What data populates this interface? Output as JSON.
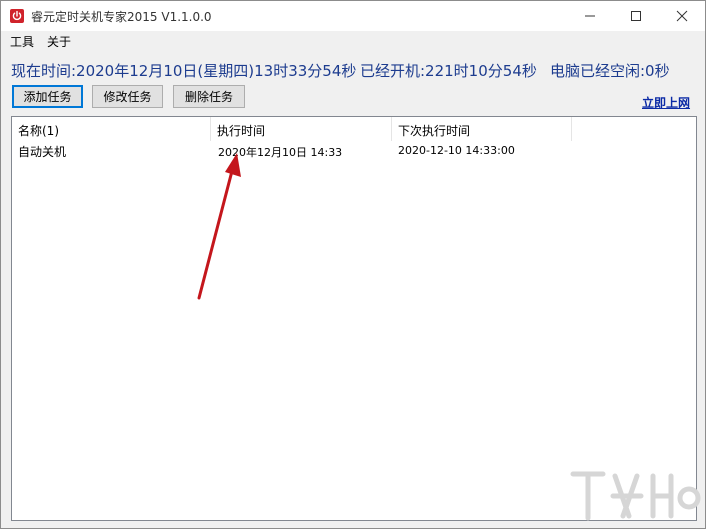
{
  "window": {
    "title": "睿元定时关机专家2015 V1.1.0.0"
  },
  "menu": {
    "tools": "工具",
    "about": "关于"
  },
  "status": {
    "current_time": "现在时间:2020年12月10日(星期四)13时33分54秒",
    "uptime": "已经开机:221时10分54秒",
    "idle": "电脑已经空闲:0秒"
  },
  "toolbar": {
    "add_label": "添加任务",
    "edit_label": "修改任务",
    "delete_label": "删除任务",
    "online_link": "立即上网"
  },
  "table": {
    "columns": [
      "名称(1)",
      "执行时间",
      "下次执行时间"
    ],
    "rows": [
      {
        "name": "自动关机",
        "exec_time": "2020年12月10日 14:33",
        "next_time": "2020-12-10 14:33:00"
      }
    ]
  },
  "colors": {
    "status_text": "#1d3c8f",
    "link": "#0b2aa6",
    "app_icon": "#d0232b",
    "annotation_arrow": "#c4161c"
  },
  "icons": {
    "app": "power-icon",
    "minimize": "minimize-icon",
    "maximize": "maximize-icon",
    "close": "close-icon"
  }
}
